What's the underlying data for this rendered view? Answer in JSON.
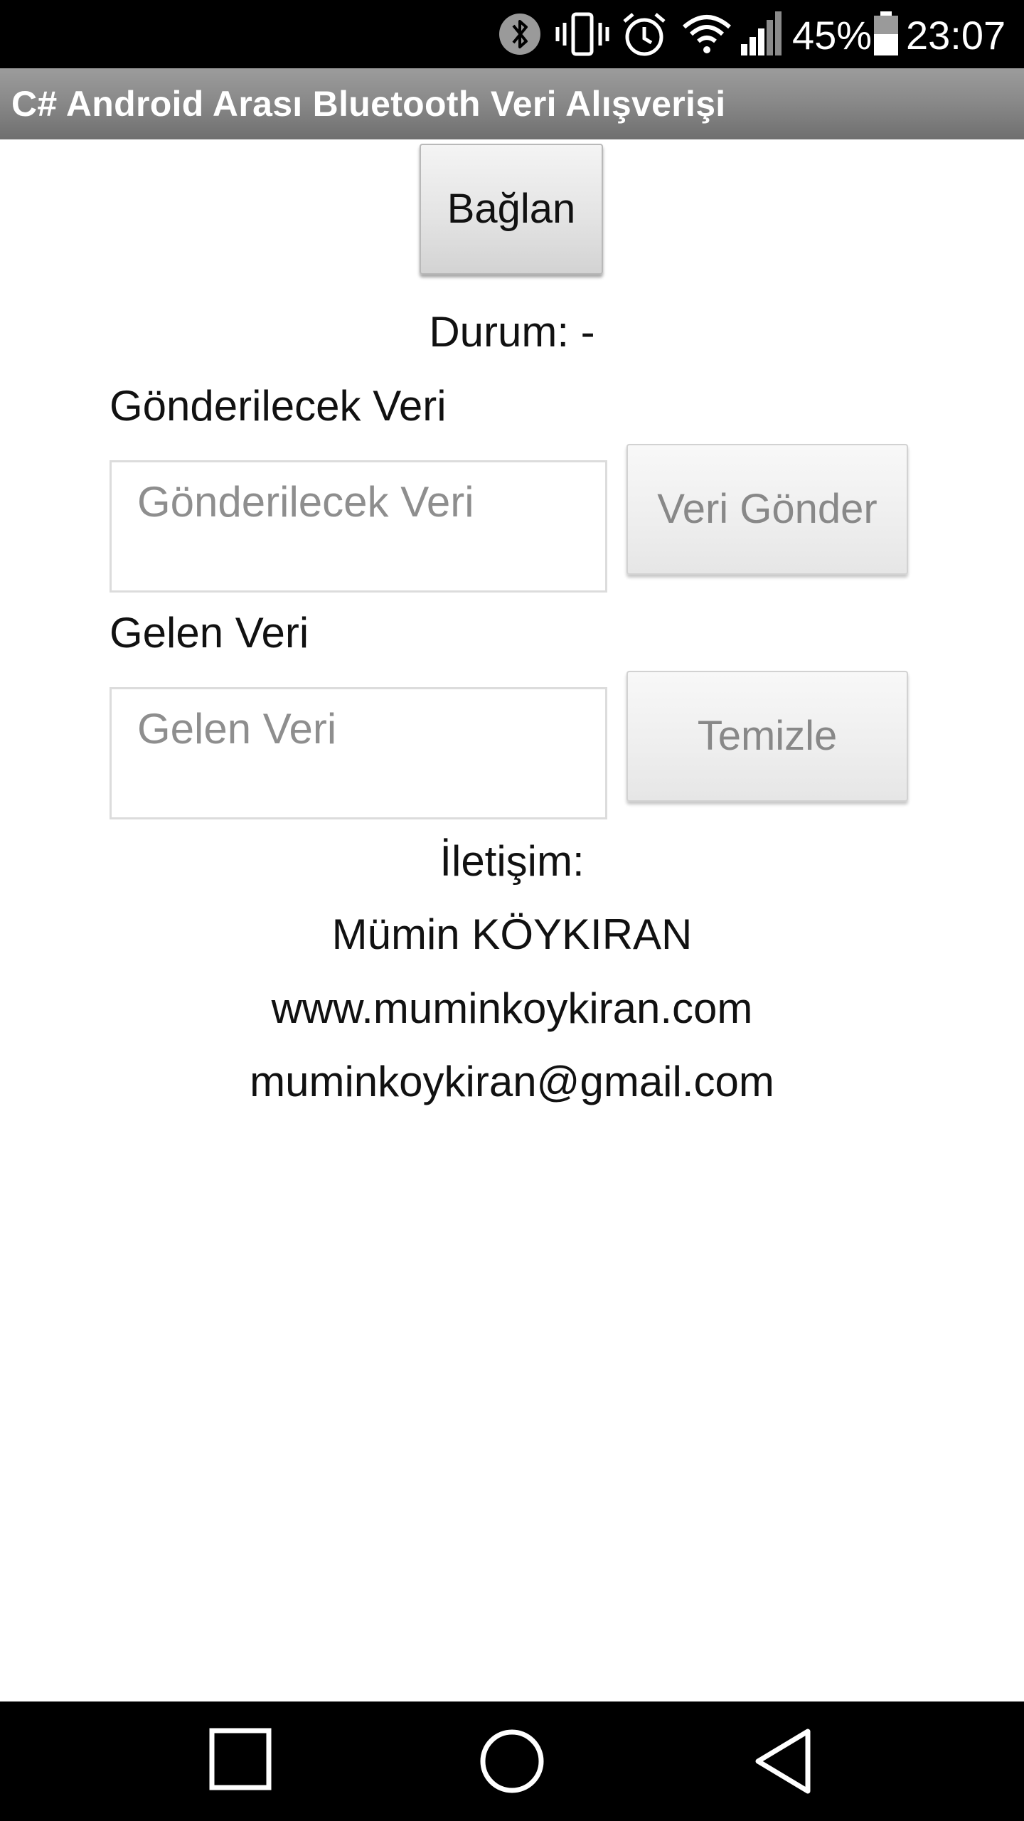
{
  "status_bar": {
    "battery_percent": "45%",
    "time": "23:07",
    "icons": [
      "bluetooth-icon",
      "vibrate-icon",
      "alarm-icon",
      "wifi-icon",
      "signal-icon",
      "battery-icon"
    ]
  },
  "app": {
    "title": "C# Android Arası Bluetooth Veri Alışverişi"
  },
  "main": {
    "connect_label": "Bağlan",
    "status_text": "Durum: -",
    "send_section_label": "Gönderilecek Veri",
    "send_input": {
      "placeholder": "Gönderilecek Veri",
      "value": ""
    },
    "send_button_label": "Veri Gönder",
    "receive_section_label": "Gelen Veri",
    "receive_input": {
      "placeholder": "Gelen Veri",
      "value": ""
    },
    "clear_button_label": "Temizle"
  },
  "contact": {
    "heading": "İletişim:",
    "name": "Mümin KÖYKIRAN",
    "website": "www.muminkoykiran.com",
    "email": "muminkoykiran@gmail.com"
  },
  "nav_bar": {
    "icons": [
      "recents-icon",
      "home-icon",
      "back-icon"
    ]
  },
  "colors": {
    "status_bar_bg": "#000000",
    "title_bar_bg": "#8a8a8a",
    "background": "#ffffff",
    "disabled_text": "#888888"
  }
}
